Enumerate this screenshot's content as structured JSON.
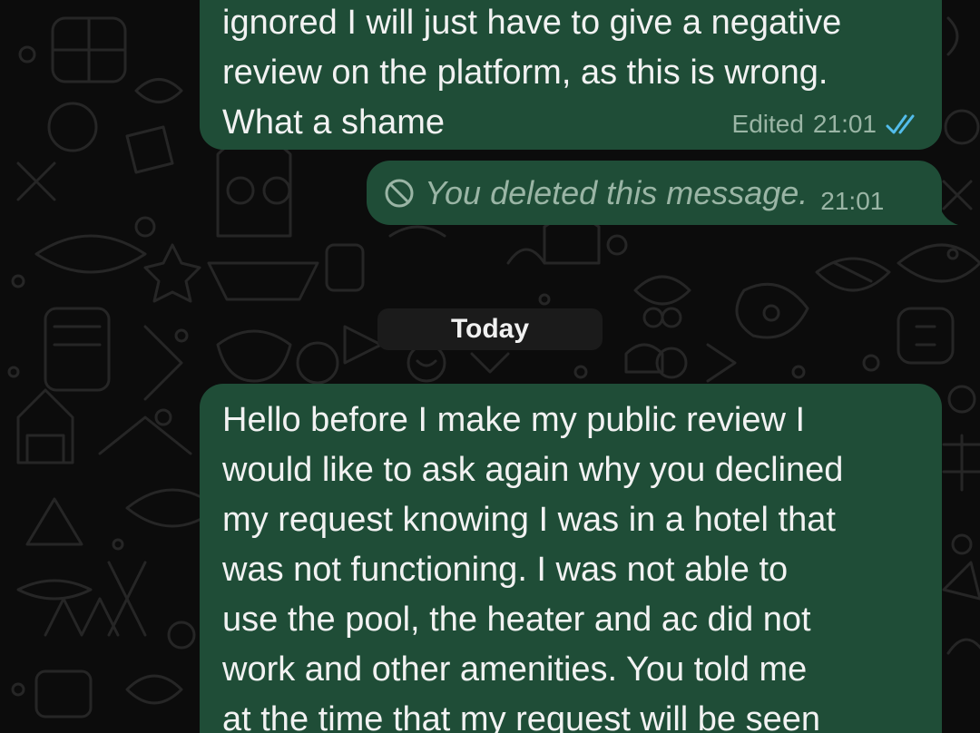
{
  "colors": {
    "background": "#0c0c0c",
    "outgoing_bubble": "#1f4d37",
    "message_text": "#f2f2f2",
    "meta_text": "#9ab5a5",
    "read_ticks": "#53bdeb",
    "date_pill": "#1b1b1b"
  },
  "messages": [
    {
      "text": "ignored I will just have to give a negative\nreview on the platform, as this is wrong.\nWhat a shame",
      "edited_label": "Edited",
      "time": "21:01",
      "status_icon": "double-check-read-icon"
    },
    {
      "deleted_icon": "blocked-circle-icon",
      "text": "You deleted this message.",
      "time": "21:01"
    },
    {
      "text": "Hello before I make my public review I\nwould like to ask again why you declined\nmy request knowing I was in a hotel that\nwas not functioning. I was not able to\nuse the pool, the heater and ac did not\nwork and other amenities. You told me\nat the time that my request will be seen"
    }
  ],
  "date_separator": "Today"
}
